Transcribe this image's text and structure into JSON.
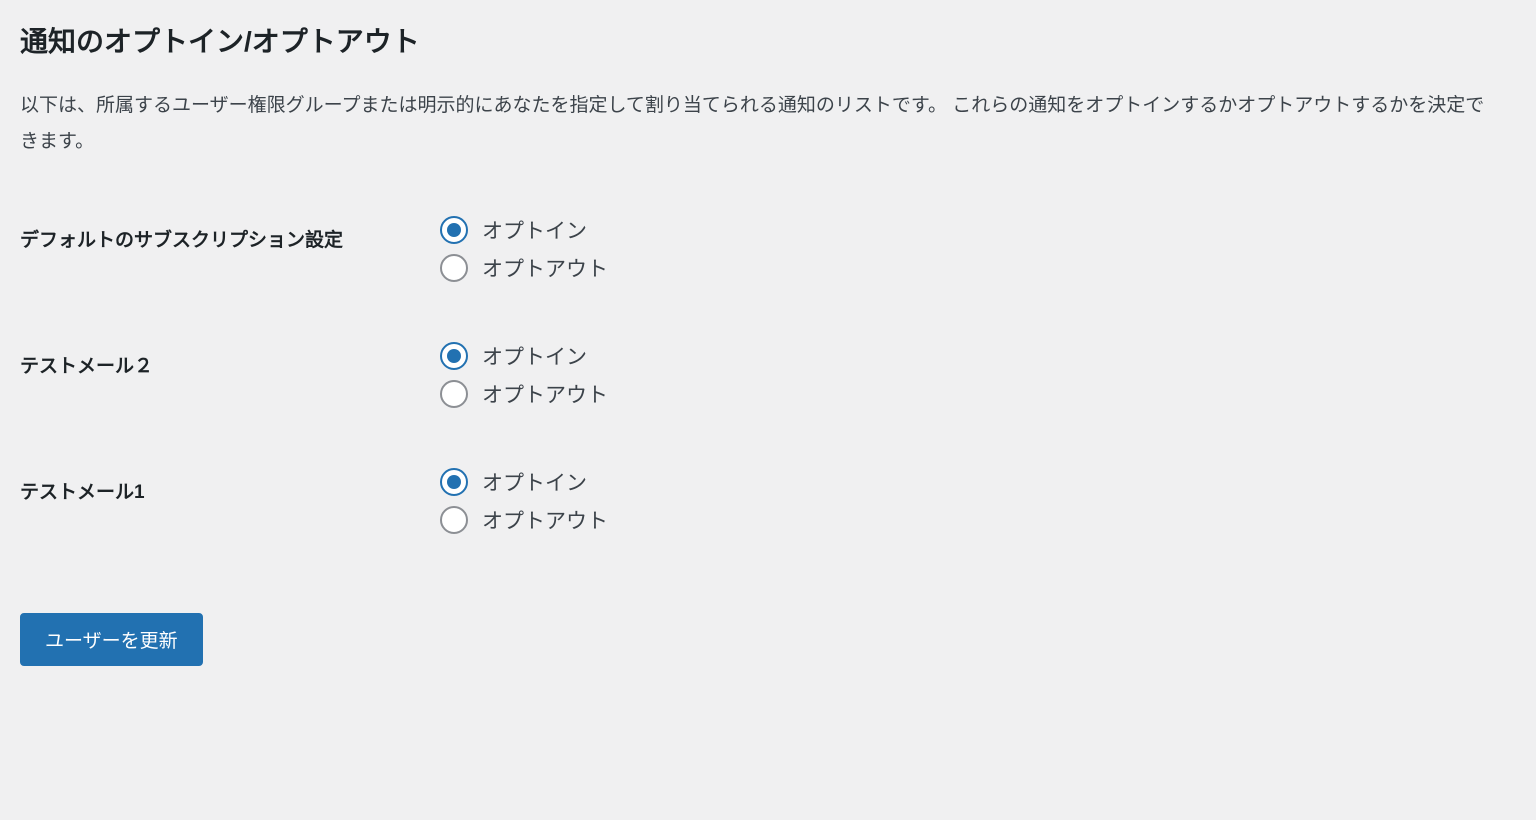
{
  "heading": "通知のオプトイン/オプトアウト",
  "description": "以下は、所属するユーザー権限グループまたは明示的にあなたを指定して割り当てられる通知のリストです。 これらの通知をオプトインするかオプトアウトするかを決定できます。",
  "settings": [
    {
      "label": "デフォルトのサブスクリプション設定",
      "optin_label": "オプトイン",
      "optout_label": "オプトアウト",
      "selected": "optin"
    },
    {
      "label": "テストメール２",
      "optin_label": "オプトイン",
      "optout_label": "オプトアウト",
      "selected": "optin"
    },
    {
      "label": "テストメール1",
      "optin_label": "オプトイン",
      "optout_label": "オプトアウト",
      "selected": "optin"
    }
  ],
  "submit_label": "ユーザーを更新"
}
